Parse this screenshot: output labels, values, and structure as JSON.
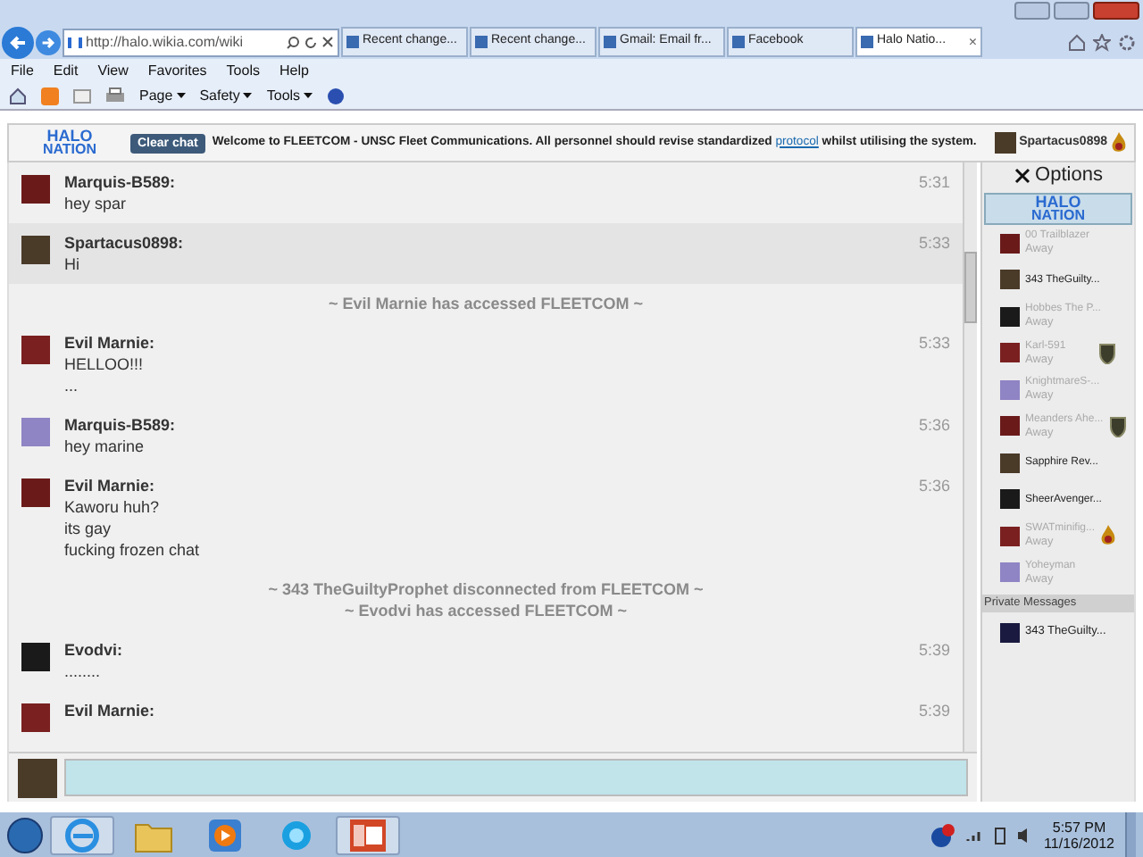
{
  "browser": {
    "address": "http://halo.wikia.com/wiki",
    "tabs": [
      {
        "label": "Recent change...",
        "selected": false
      },
      {
        "label": "Recent change...",
        "selected": false
      },
      {
        "label": "Gmail: Email fr...",
        "selected": false
      },
      {
        "label": "Facebook",
        "selected": false
      },
      {
        "label": "Halo Natio...",
        "selected": true
      }
    ],
    "close_tab": "×",
    "menu": [
      "File",
      "Edit",
      "View",
      "Favorites",
      "Tools",
      "Help"
    ],
    "commands": [
      "Page",
      "Safety",
      "Tools"
    ]
  },
  "chat": {
    "logo_top": "HALO",
    "logo_bottom": "NATION",
    "clear_button": "Clear chat",
    "welcome": "Welcome to FLEETCOM - UNSC Fleet Communications. All personnel should revise standardized",
    "welcome_link": "protocol",
    "welcome_end": "whilst utilising the system.",
    "current_user": {
      "name": "Spartacus0898",
      "badge": {
        "kind": "flame"
      }
    },
    "messages": [
      {
        "kind": "message",
        "name": "Marquis-B589:",
        "time": "5:31",
        "lines": [
          "hey spar"
        ],
        "highlighted": false
      },
      {
        "kind": "message",
        "name": "Spartacus0898:",
        "time": "5:33",
        "lines": [
          "Hi"
        ],
        "highlighted": true
      },
      {
        "kind": "notice",
        "lines": [
          "~ Evil Marnie has accessed FLEETCOM ~"
        ]
      },
      {
        "kind": "message",
        "name": "Evil Marnie:",
        "time": "5:33",
        "lines": [
          "HELLOO!!!",
          "..."
        ],
        "highlighted": false
      },
      {
        "kind": "message",
        "name": "Marquis-B589:",
        "time": "5:36",
        "lines": [
          "hey marine"
        ],
        "highlighted": false
      },
      {
        "kind": "message",
        "name": "Evil Marnie:",
        "time": "5:36",
        "lines": [
          "Kaworu huh?",
          "its gay",
          "fucking frozen chat"
        ],
        "highlighted": false
      },
      {
        "kind": "notice",
        "lines": [
          "~ 343 TheGuiltyProphet disconnected from FLEETCOM ~",
          "~ Evodvi has accessed FLEETCOM ~"
        ]
      },
      {
        "kind": "message",
        "name": "Evodvi:",
        "time": "5:39",
        "lines": [
          "........"
        ],
        "highlighted": false
      },
      {
        "kind": "message",
        "name": "Evil Marnie:",
        "time": "5:39",
        "highlighted": false
      }
    ],
    "options": "Options",
    "banner_top": "HALO",
    "banner_bottom": "NATION",
    "users": [
      {
        "name": "00 Trailblazer",
        "status": "Away",
        "away": true
      },
      {
        "name": "343 TheGuilty...",
        "away": false
      },
      {
        "name": "Hobbes The P...",
        "status": "Away",
        "away": true
      },
      {
        "name": "Karl-591",
        "status": "Away",
        "away": true,
        "badge": {
          "kind": "shield"
        }
      },
      {
        "name": "KnightmareS-...",
        "status": "Away",
        "away": true
      },
      {
        "name": "Meanders Ahe...",
        "status": "Away",
        "away": true,
        "badge": {
          "kind": "shield"
        }
      },
      {
        "name": "Sapphire Rev...",
        "away": false
      },
      {
        "name": "SheerAvenger...",
        "away": false
      },
      {
        "name": "SWATminifig...",
        "status": "Away",
        "away": true,
        "badge": {
          "kind": "flame"
        }
      },
      {
        "name": "Yoheyman",
        "status": "Away",
        "away": true
      }
    ],
    "private_heading": "Private Messages",
    "private_users": [
      {
        "name": "343 TheGuilty..."
      }
    ]
  },
  "taskbar": {
    "apps": [
      {
        "kind": "ie",
        "selected": true
      },
      {
        "kind": "folder",
        "selected": false
      },
      {
        "kind": "media",
        "selected": false
      },
      {
        "kind": "orb",
        "selected": false
      },
      {
        "kind": "slides",
        "selected": true
      }
    ],
    "time": "5:57 PM",
    "date": "11/16/2012"
  }
}
